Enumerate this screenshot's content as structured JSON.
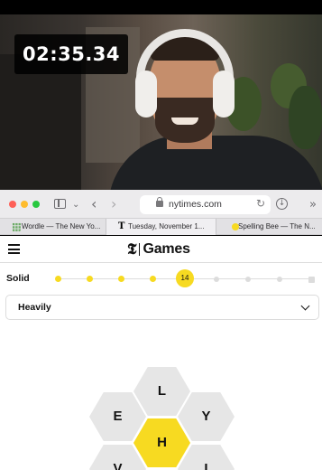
{
  "webcam": {
    "timer": "02:35.34"
  },
  "browser": {
    "url": "nytimes.com",
    "icons": [
      "sidebar-toggle-icon",
      "chevron-down-icon",
      "back-arrow-icon",
      "forward-arrow-icon",
      "lock-icon",
      "reload-icon",
      "download-icon",
      "more-tabs-icon"
    ],
    "tabs": [
      {
        "title": "Wordle — The New Yo...",
        "icon": "wordle-favicon"
      },
      {
        "title": "Tuesday, November 1...",
        "icon": "nyt-favicon"
      },
      {
        "title": "Spelling Bee — The N...",
        "icon": "bee-favicon"
      }
    ]
  },
  "page": {
    "logo_mark": "𝕿",
    "logo_text": "Games",
    "rank": {
      "label": "Solid",
      "score": "14",
      "completed_levels": 4,
      "total_levels": 9
    },
    "found_words_preview": "Heavily",
    "hive": {
      "center": "H",
      "outer": [
        "L",
        "E",
        "Y",
        "V",
        "I"
      ]
    }
  },
  "colors": {
    "bee_yellow": "#f7da21",
    "hex_gray": "#e6e6e6",
    "timer_bg": "#000000",
    "tab_bar": "#e2e1e4"
  }
}
